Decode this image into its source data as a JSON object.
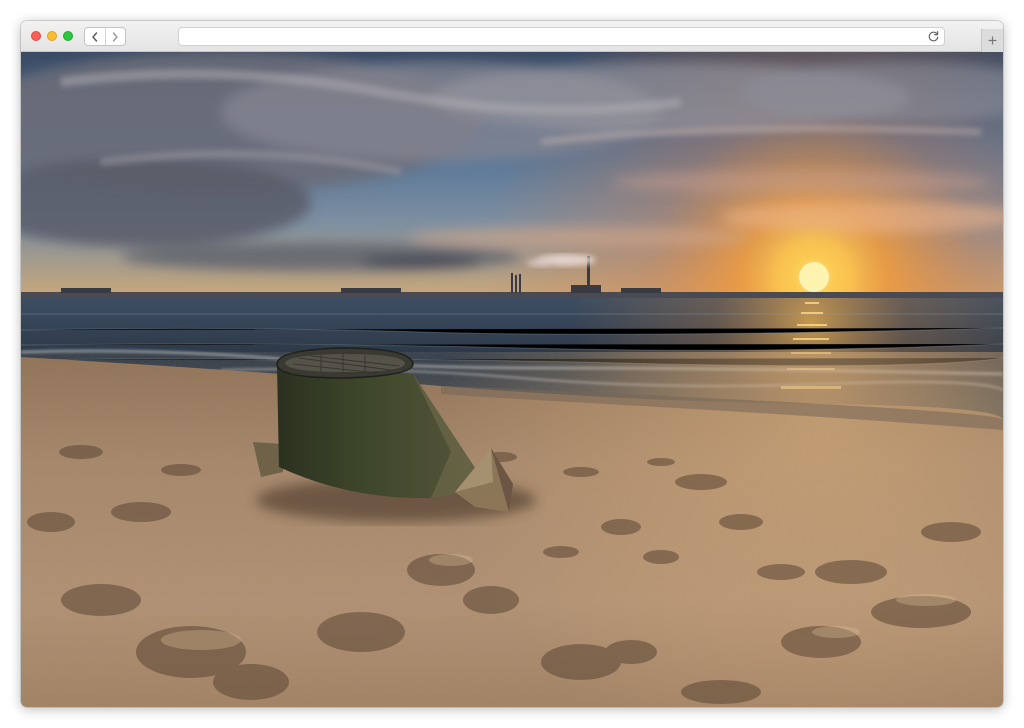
{
  "browser": {
    "address_value": "",
    "address_placeholder": "",
    "icons": {
      "close": "close-window-dot",
      "minimize": "minimize-window-dot",
      "zoom": "zoom-window-dot",
      "back": "chevron-left-icon",
      "forward": "chevron-right-icon",
      "reload": "reload-icon",
      "new_tab": "plus-icon"
    },
    "colors": {
      "close": "#fc5f57",
      "minimize": "#fdbc2e",
      "zoom": "#28c840"
    }
  },
  "content": {
    "image": "beach-sunset-photo"
  }
}
